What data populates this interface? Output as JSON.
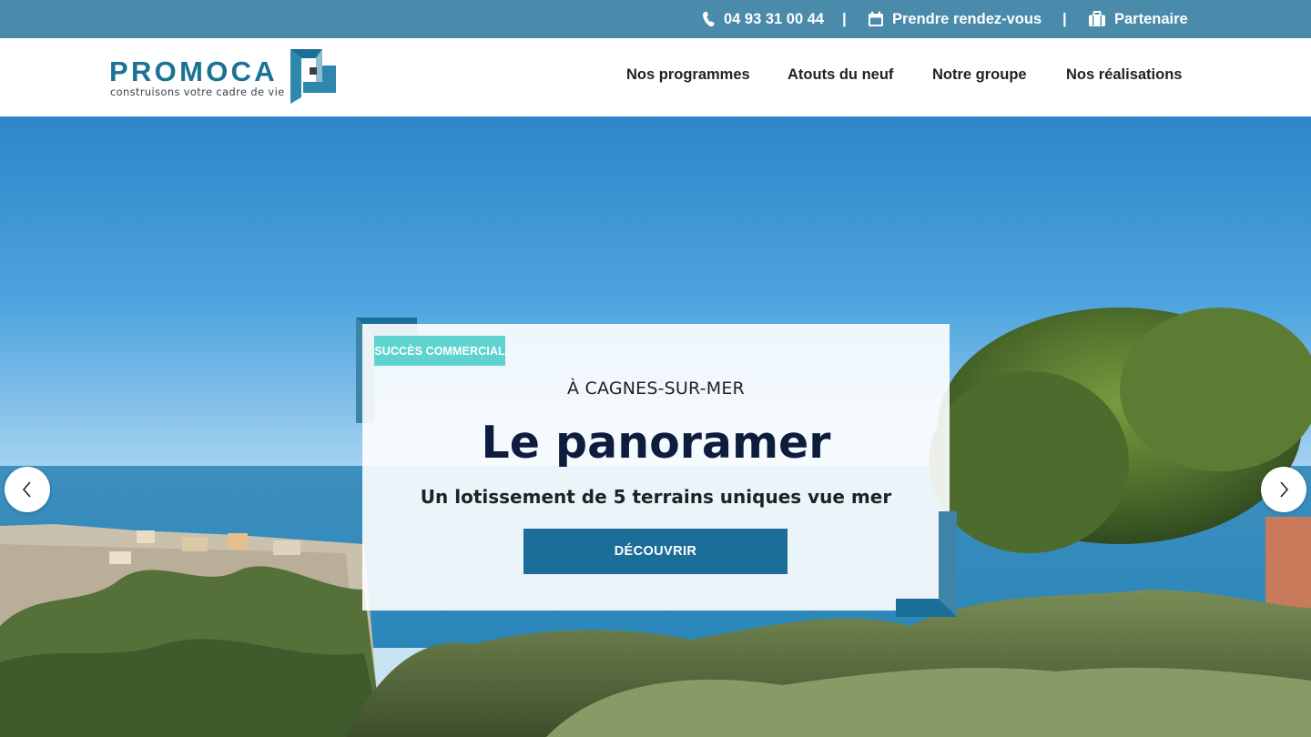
{
  "topbar": {
    "phone": "04 93 31 00 44",
    "separator": "|",
    "appointment": "Prendre rendez-vous",
    "partner": "Partenaire",
    "icons": {
      "phone": "phone-icon",
      "appointment": "calendar-icon",
      "partner": "briefcase-icon"
    },
    "bg_color": "#4a8aab"
  },
  "logo": {
    "name": "PROMOCA",
    "tagline": "construisons votre cadre de vie",
    "color": "#1b7294"
  },
  "nav": {
    "items": [
      {
        "label": "Nos programmes"
      },
      {
        "label": "Atouts du neuf"
      },
      {
        "label": "Notre groupe"
      },
      {
        "label": "Nos réalisations"
      }
    ]
  },
  "hero": {
    "badge": "SUCCÈS COMMERCIAL",
    "location": "À CAGNES-SUR-MER",
    "title": "Le panoramer",
    "subtitle": "Un lotissement de 5 terrains uniques vue mer",
    "cta": "DÉCOUVRIR",
    "prev_icon": "chevron-left-icon",
    "next_icon": "chevron-right-icon",
    "badge_color": "#5fd3d0",
    "cta_color": "#1b6e97",
    "title_color": "#0e1d3e"
  }
}
